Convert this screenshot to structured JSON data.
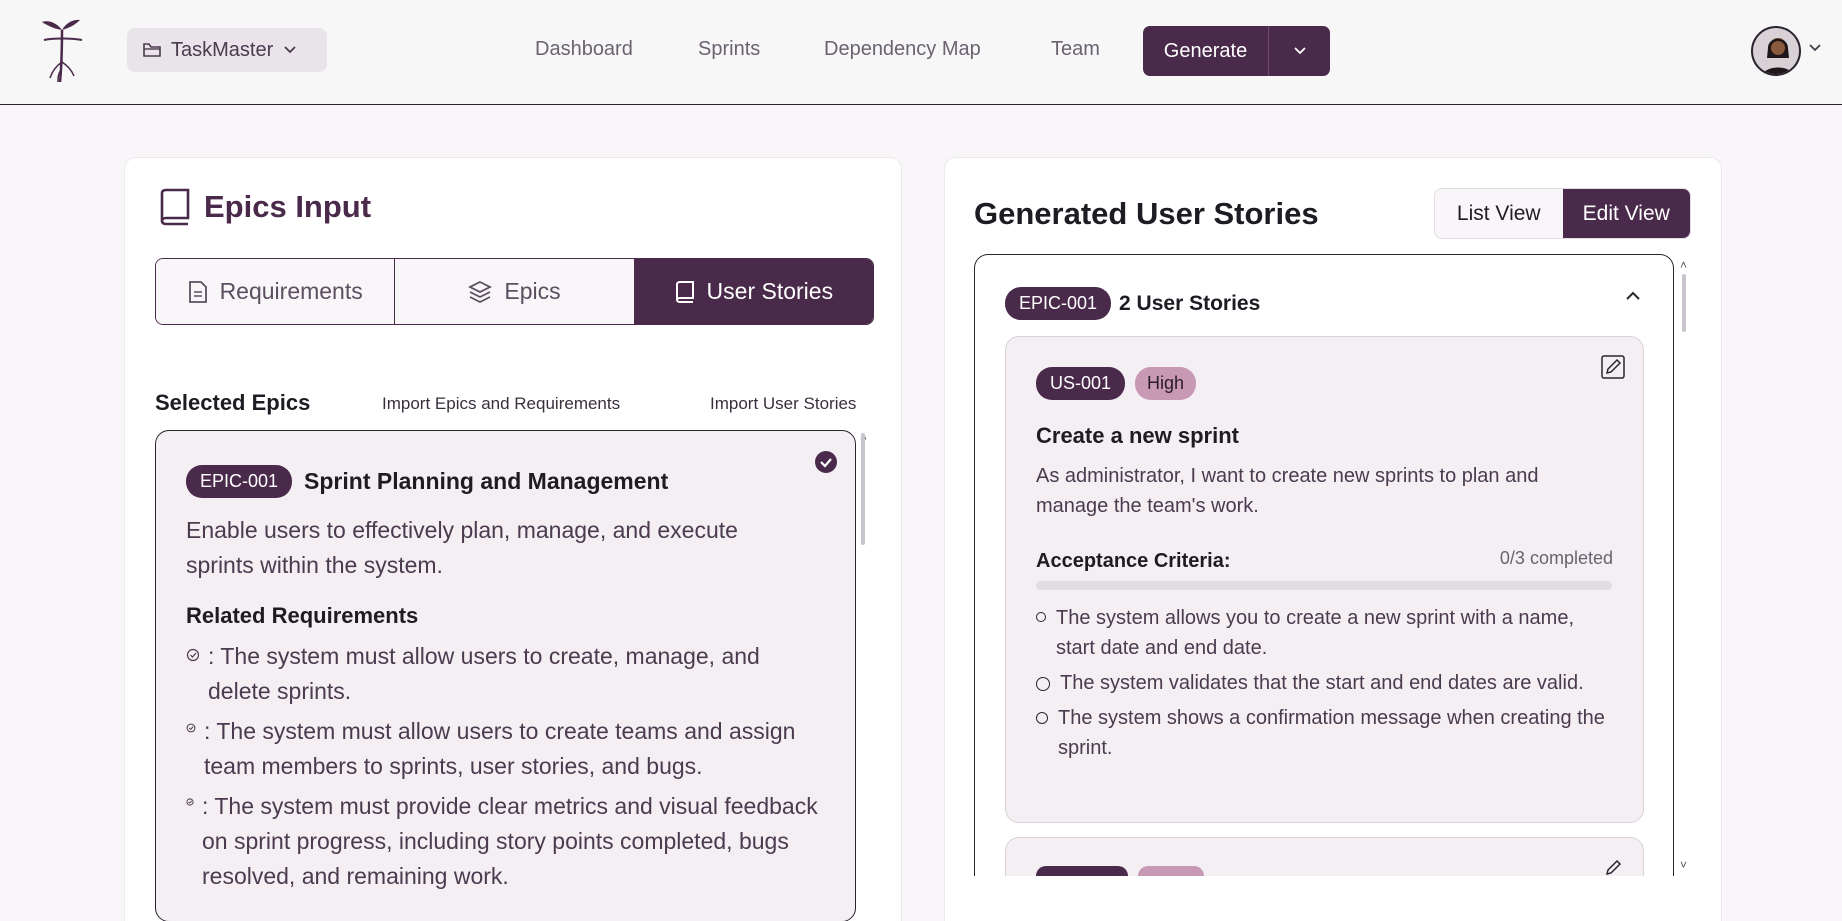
{
  "header": {
    "project_name": "TaskMaster",
    "nav": [
      "Dashboard",
      "Sprints",
      "Dependency Map",
      "Team"
    ],
    "generate_label": "Generate"
  },
  "left": {
    "title": "Epics Input",
    "tabs": [
      {
        "label": "Requirements",
        "icon": "document-icon"
      },
      {
        "label": "Epics",
        "icon": "layers-icon"
      },
      {
        "label": "User Stories",
        "icon": "book-icon",
        "active": true
      }
    ],
    "selected_title": "Selected Epics",
    "import_epics": "Import Epics and Requirements",
    "import_stories": "Import User Stories",
    "epic": {
      "id": "EPIC-001",
      "name": "Sprint Planning and Management",
      "description": "Enable users to effectively plan, manage, and execute sprints within the system.",
      "req_title": "Related Requirements",
      "requirements": [
        ": The system must allow users to create, manage, and delete sprints.",
        ": The system must allow users to create teams and assign team members to sprints, user stories, and bugs.",
        ": The system must provide clear metrics and visual feedback on sprint progress, including story points completed, bugs resolved, and remaining work."
      ]
    }
  },
  "right": {
    "title": "Generated User Stories",
    "view_list": "List View",
    "view_edit": "Edit View",
    "group": {
      "epic_id": "EPIC-001",
      "count_label": "2 User Stories"
    },
    "story": {
      "id": "US-001",
      "priority": "High",
      "title": "Create a new sprint",
      "description": "As administrator, I want to create new sprints to plan and manage the team's work.",
      "ac_title": "Acceptance Criteria:",
      "ac_progress": "0/3 completed",
      "ac_fraction": 0,
      "criteria": [
        "The system allows you to create a new sprint with a name, start date and end date.",
        "The system validates that the start and end dates are valid.",
        "The system shows a confirmation message when creating the sprint."
      ]
    }
  },
  "colors": {
    "primary": "#4a2a4a",
    "priority_high": "#c899b4",
    "card_bg": "#f4eff3"
  }
}
